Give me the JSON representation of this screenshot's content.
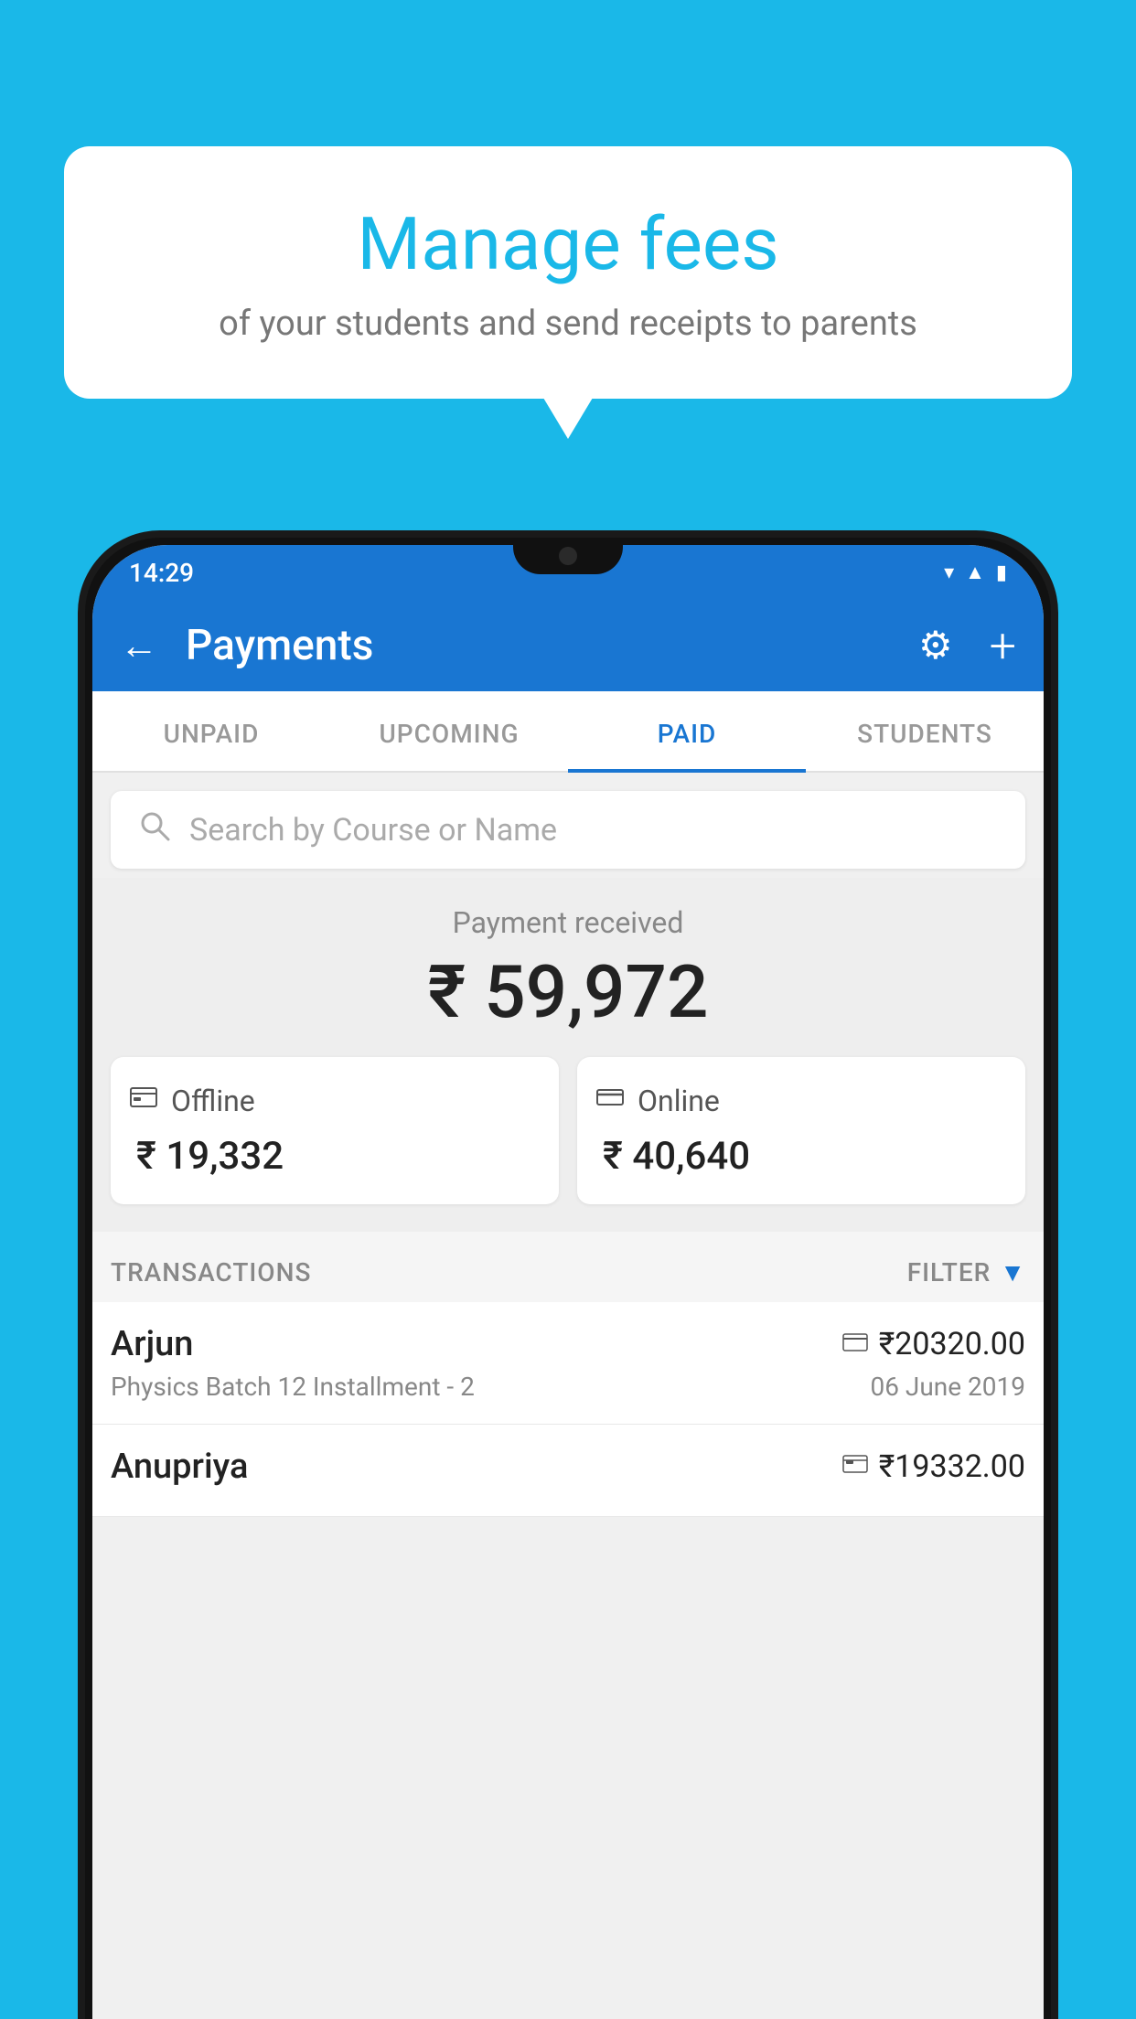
{
  "background_color": "#1ab8e8",
  "speech_bubble": {
    "title": "Manage fees",
    "subtitle": "of your students and send receipts to parents"
  },
  "status_bar": {
    "time": "14:29",
    "icons": [
      "wifi",
      "signal",
      "battery"
    ]
  },
  "header": {
    "title": "Payments",
    "back_label": "←",
    "gear_label": "⚙",
    "plus_label": "+"
  },
  "tabs": [
    {
      "label": "UNPAID",
      "active": false
    },
    {
      "label": "UPCOMING",
      "active": false
    },
    {
      "label": "PAID",
      "active": true
    },
    {
      "label": "STUDENTS",
      "active": false
    }
  ],
  "search": {
    "placeholder": "Search by Course or Name"
  },
  "payment_section": {
    "label": "Payment received",
    "amount": "₹ 59,972",
    "offline": {
      "label": "Offline",
      "amount": "₹ 19,332"
    },
    "online": {
      "label": "Online",
      "amount": "₹ 40,640"
    }
  },
  "transactions": {
    "header_label": "TRANSACTIONS",
    "filter_label": "FILTER",
    "rows": [
      {
        "name": "Arjun",
        "course": "Physics Batch 12 Installment - 2",
        "amount": "₹20320.00",
        "date": "06 June 2019",
        "type": "online"
      },
      {
        "name": "Anupriya",
        "course": "",
        "amount": "₹19332.00",
        "date": "",
        "type": "offline"
      }
    ]
  }
}
